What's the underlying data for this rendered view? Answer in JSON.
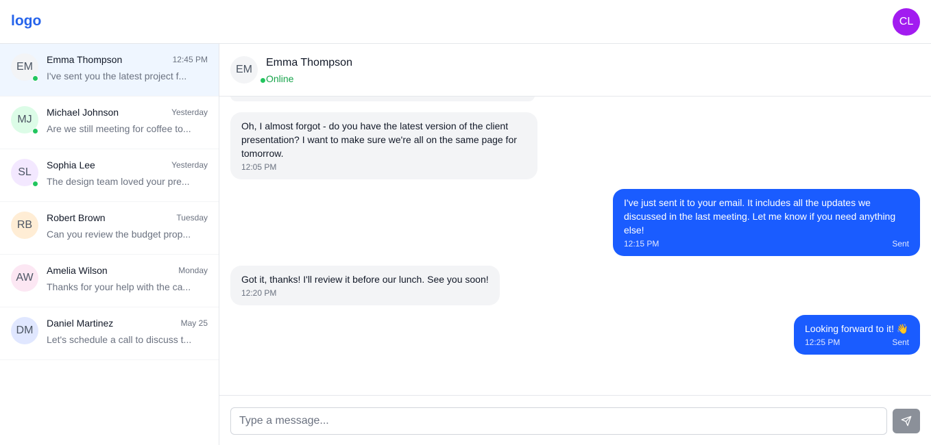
{
  "header": {
    "logo": "logo",
    "user_initials": "CL",
    "user_avatar_color": "#a21cf0"
  },
  "conversations": [
    {
      "initials": "EM",
      "name": "Emma Thompson",
      "time": "12:45 PM",
      "preview": "I've sent you the latest project f...",
      "online": true,
      "avatar_color": "#f3f4f6",
      "active": true
    },
    {
      "initials": "MJ",
      "name": "Michael Johnson",
      "time": "Yesterday",
      "preview": "Are we still meeting for coffee to...",
      "online": true,
      "avatar_color": "#dcfce7",
      "active": false
    },
    {
      "initials": "SL",
      "name": "Sophia Lee",
      "time": "Yesterday",
      "preview": "The design team loved your pre...",
      "online": true,
      "avatar_color": "#f3e8ff",
      "active": false
    },
    {
      "initials": "RB",
      "name": "Robert Brown",
      "time": "Tuesday",
      "preview": "Can you review the budget prop...",
      "online": false,
      "avatar_color": "#ffedd5",
      "active": false
    },
    {
      "initials": "AW",
      "name": "Amelia Wilson",
      "time": "Monday",
      "preview": "Thanks for your help with the ca...",
      "online": false,
      "avatar_color": "#fce7f3",
      "active": false
    },
    {
      "initials": "DM",
      "name": "Daniel Martinez",
      "time": "May 25",
      "preview": "Let's schedule a call to discuss t...",
      "online": false,
      "avatar_color": "#e0e7ff",
      "active": false
    }
  ],
  "chat": {
    "initials": "EM",
    "name": "Emma Thompson",
    "status": "Online",
    "messages": [
      {
        "direction": "in",
        "text": "Oh, I almost forgot - do you have the latest version of the client presentation? I want to make sure we're all on the same page for tomorrow.",
        "time": "12:05 PM",
        "status": ""
      },
      {
        "direction": "out",
        "text": "I've just sent it to your email. It includes all the updates we discussed in the last meeting. Let me know if you need anything else!",
        "time": "12:15 PM",
        "status": "Sent"
      },
      {
        "direction": "in",
        "text": "Got it, thanks! I'll review it before our lunch. See you soon!",
        "time": "12:20 PM",
        "status": ""
      },
      {
        "direction": "out",
        "text": "Looking forward to it! 👋",
        "time": "12:25 PM",
        "status": "Sent"
      }
    ]
  },
  "composer": {
    "placeholder": "Type a message...",
    "send_icon": "send-icon"
  },
  "colors": {
    "accent": "#2563eb",
    "outgoing_bubble": "#1a5cff",
    "incoming_bubble": "#f3f4f6",
    "online": "#22c55e"
  }
}
